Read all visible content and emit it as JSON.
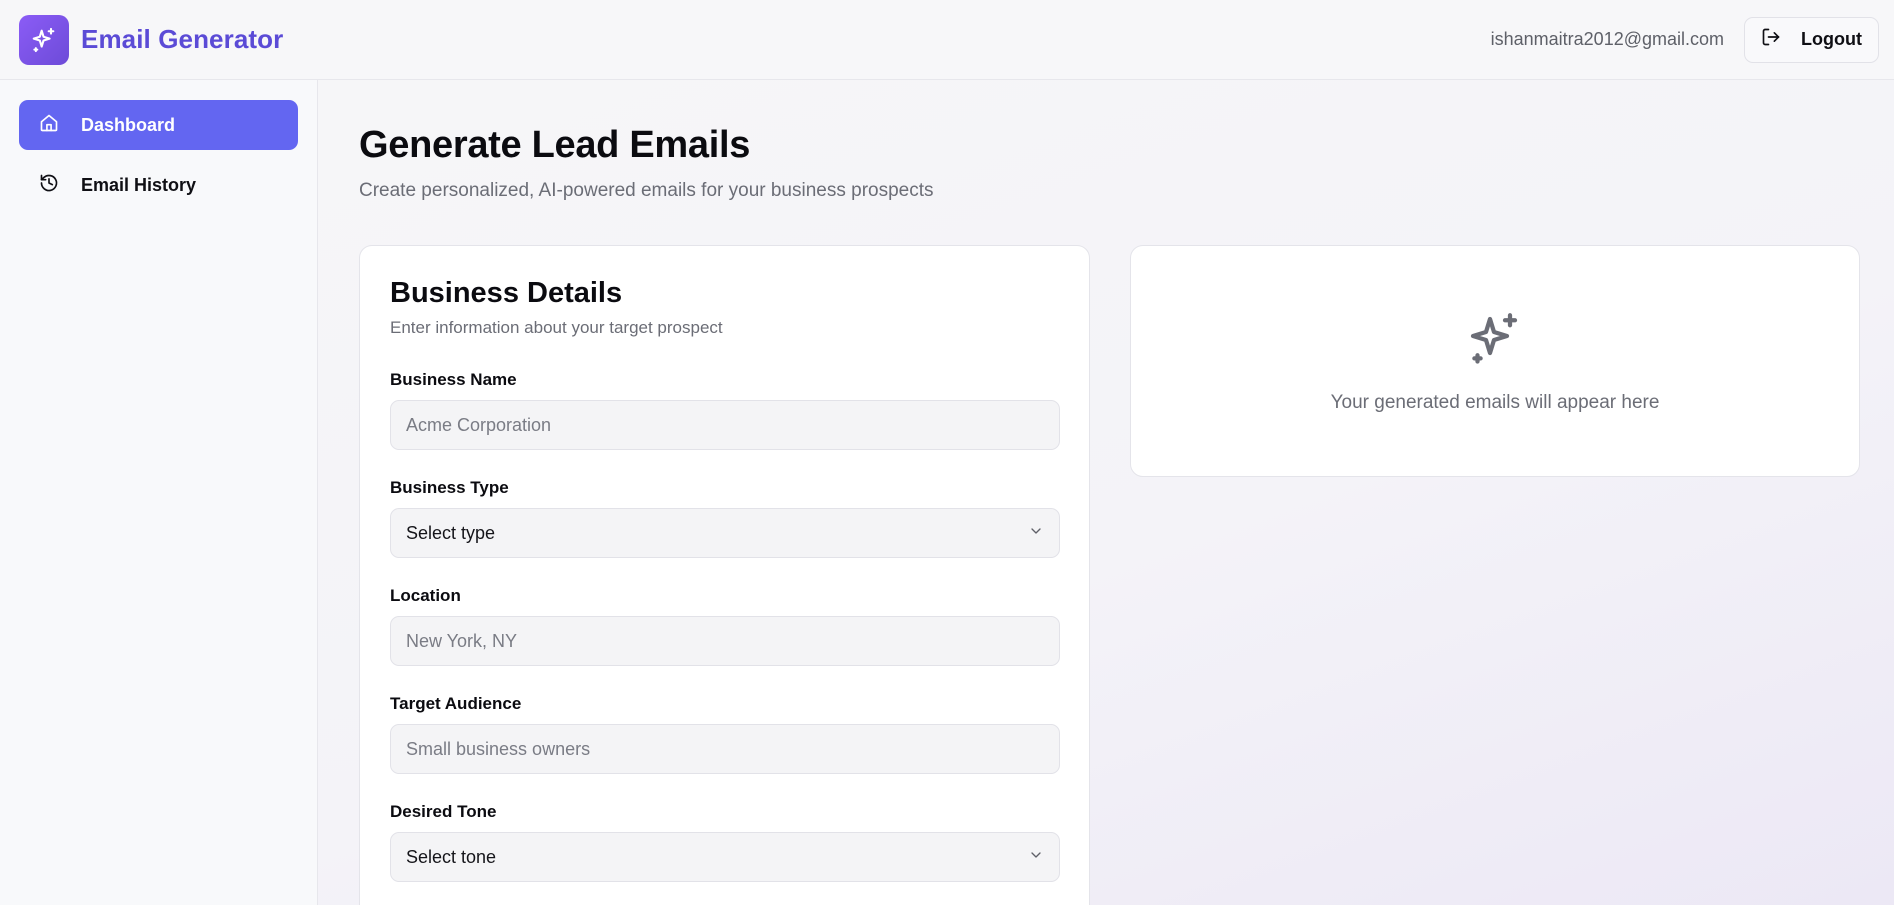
{
  "header": {
    "brand_title": "Email Generator",
    "user_email": "ishanmaitra2012@gmail.com",
    "logout_label": "Logout"
  },
  "sidebar": {
    "items": [
      {
        "label": "Dashboard",
        "icon": "home-icon",
        "active": true
      },
      {
        "label": "Email History",
        "icon": "history-icon",
        "active": false
      }
    ]
  },
  "main": {
    "title": "Generate Lead Emails",
    "subtitle": "Create personalized, AI-powered emails for your business prospects"
  },
  "form": {
    "title": "Business Details",
    "subtitle": "Enter information about your target prospect",
    "business_name": {
      "label": "Business Name",
      "placeholder": "Acme Corporation"
    },
    "business_type": {
      "label": "Business Type",
      "value": "Select type"
    },
    "location": {
      "label": "Location",
      "placeholder": "New York, NY"
    },
    "target_audience": {
      "label": "Target Audience",
      "placeholder": "Small business owners"
    },
    "desired_tone": {
      "label": "Desired Tone",
      "value": "Select tone"
    }
  },
  "output": {
    "empty_text": "Your generated emails will appear here",
    "icon": "sparkles-icon"
  },
  "colors": {
    "accent": "#6366f1",
    "brand_text": "#5b4bd6",
    "logo_gradient_start": "#8b5cf6",
    "logo_gradient_end": "#6d4bd8"
  }
}
